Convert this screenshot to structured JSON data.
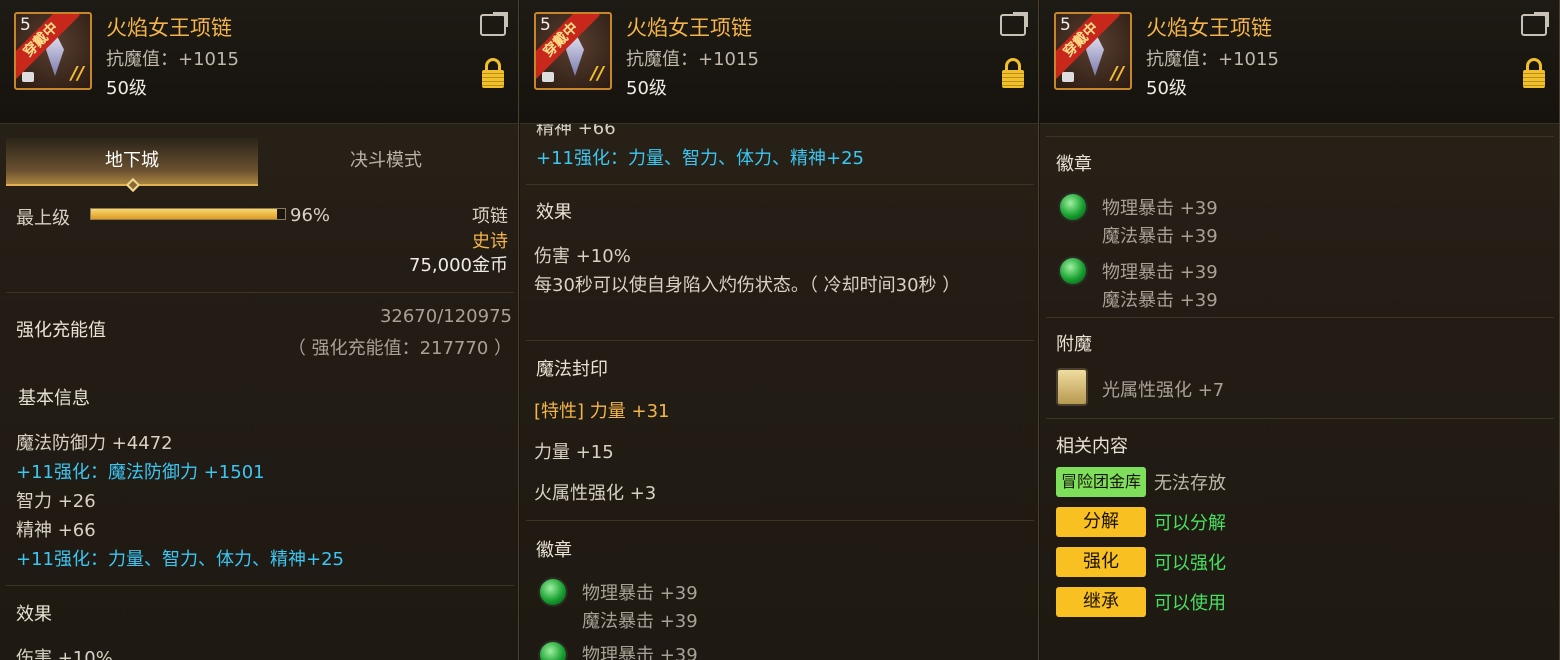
{
  "item": {
    "name": "火焰女王项链",
    "resist": "抗魔值：+1015",
    "level": "50级",
    "icon_level": "5",
    "icon_ribbon": "穿戴中",
    "icon_mark": "//"
  },
  "tabs": [
    "地下城",
    "决斗模式"
  ],
  "grade": {
    "label": "最上级",
    "percent_text": "96%",
    "percent": 0.96
  },
  "slot": {
    "type": "项链",
    "rarity": "史诗",
    "price": "75,000金币"
  },
  "charge": {
    "label": "强化充能值",
    "value": "32670/120975",
    "sub": "（ 强化充能值：217770 ）"
  },
  "basic": {
    "title": "基本信息",
    "lines": [
      "魔法防御力 +4472",
      "+11强化：魔法防御力 +1501",
      "智力 +26",
      "精神 +66",
      "+11强化：力量、智力、体力、精神+25"
    ]
  },
  "effect": {
    "title": "效果",
    "lines": [
      "伤害 +10%",
      "每30秒可以使自身陷入灼伤状态。（ 冷却时间30秒 ）"
    ],
    "p1_partial": "伤害 +10%"
  },
  "p2_top_partial": "精神 +66",
  "seal": {
    "title": "魔法封印",
    "lines": [
      "[特性] 力量 +31",
      "力量 +15",
      "火属性强化 +3"
    ]
  },
  "emblem": {
    "title": "徽章",
    "items": [
      {
        "a": "物理暴击 +39",
        "b": "魔法暴击 +39"
      },
      {
        "a": "物理暴击 +39",
        "b": "魔法暴击 +39"
      }
    ],
    "p2_partial": "物理暴击 +39"
  },
  "enchant": {
    "title": "附魔",
    "value": "光属性强化 +7"
  },
  "related": {
    "title": "相关内容",
    "rows": [
      {
        "badge": "冒险团金库",
        "text": "无法存放",
        "badge_color": "#7ee05a",
        "text_color": "#bfb8aa"
      },
      {
        "badge": "分解",
        "text": "可以分解",
        "badge_color": "#f8c020",
        "text_color": "#48e060"
      },
      {
        "badge": "强化",
        "text": "可以强化",
        "badge_color": "#f8c020",
        "text_color": "#48e060"
      },
      {
        "badge": "继承",
        "text": "可以使用",
        "badge_color": "#f8c020",
        "text_color": "#48e060"
      }
    ]
  }
}
